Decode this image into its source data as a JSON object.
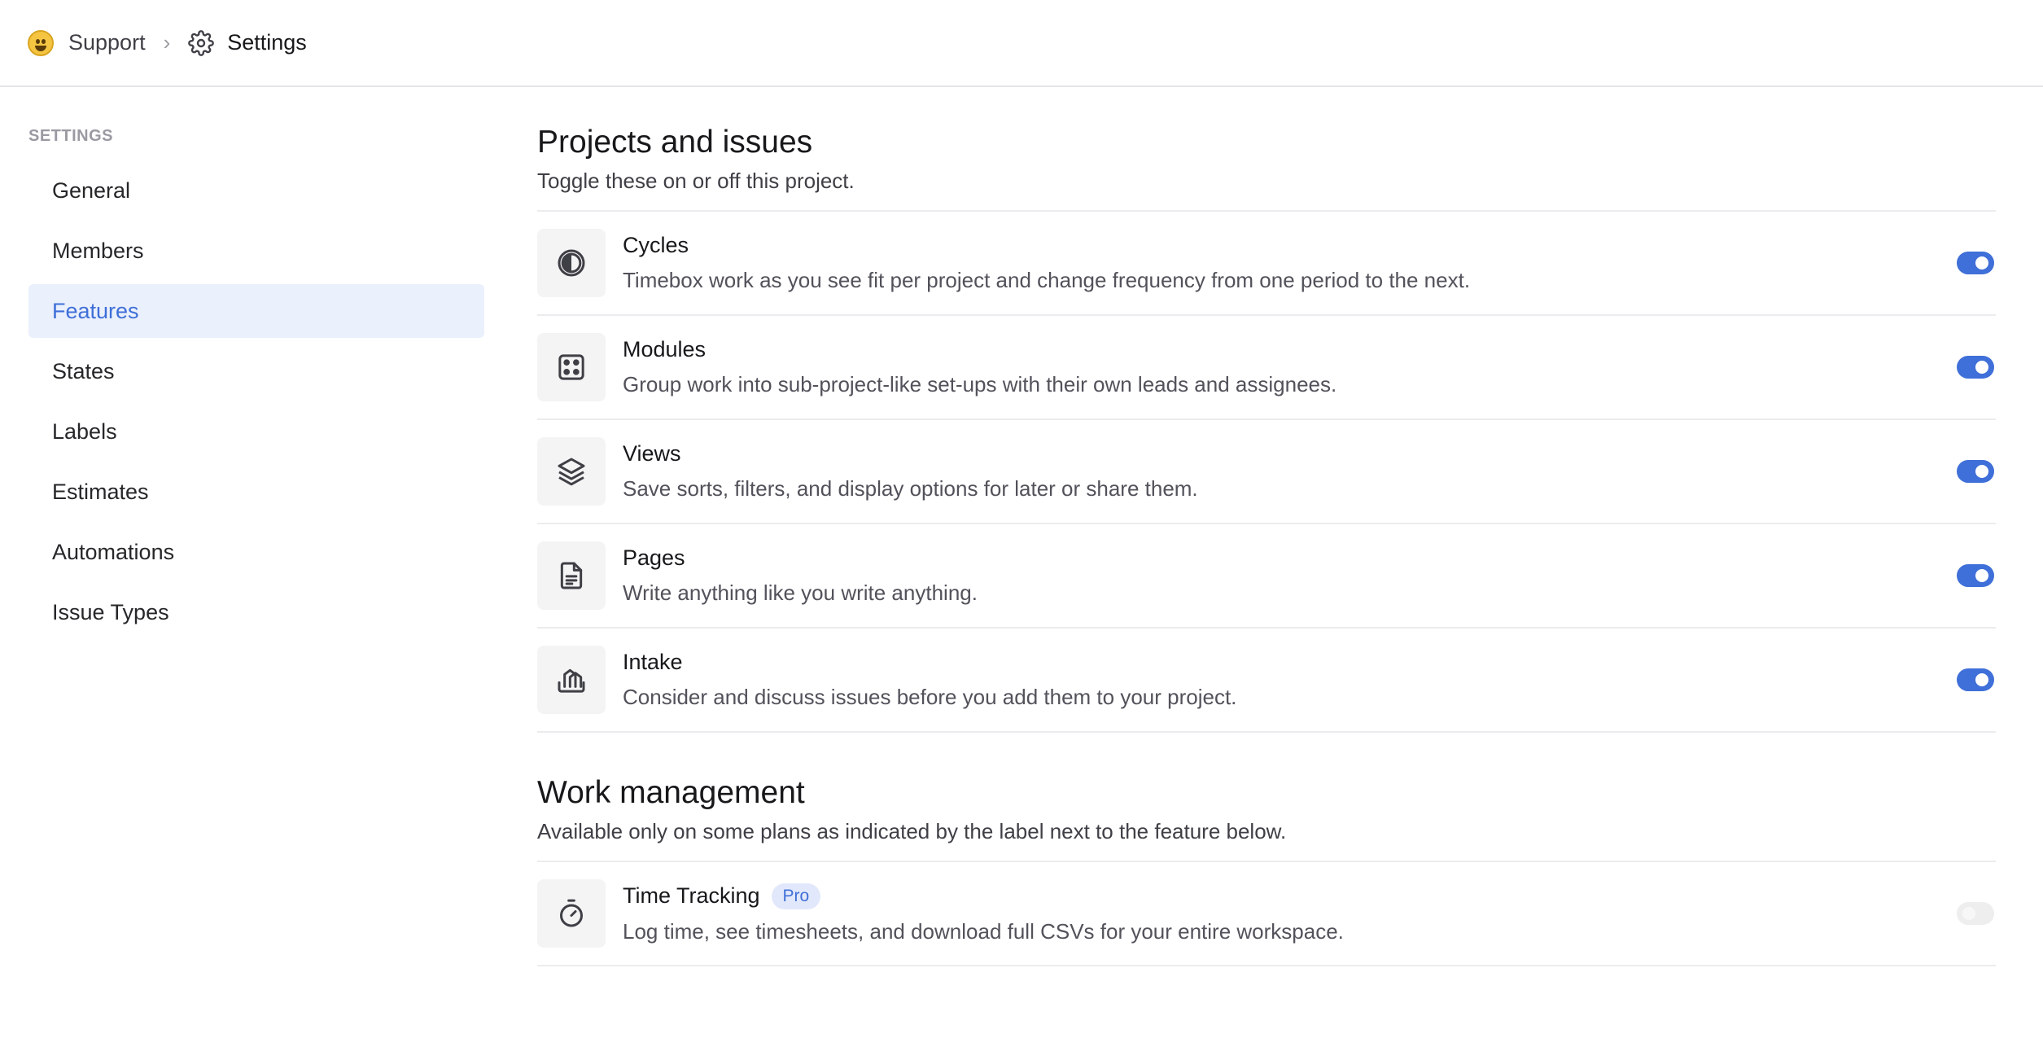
{
  "breadcrumb": {
    "project": "Support",
    "separator": "›",
    "page": "Settings"
  },
  "sidebar": {
    "heading": "SETTINGS",
    "items": [
      {
        "label": "General",
        "active": false
      },
      {
        "label": "Members",
        "active": false
      },
      {
        "label": "Features",
        "active": true
      },
      {
        "label": "States",
        "active": false
      },
      {
        "label": "Labels",
        "active": false
      },
      {
        "label": "Estimates",
        "active": false
      },
      {
        "label": "Automations",
        "active": false
      },
      {
        "label": "Issue Types",
        "active": false
      }
    ]
  },
  "projects_section": {
    "title": "Projects and issues",
    "subtitle": "Toggle these on or off this project.",
    "features": [
      {
        "icon": "contrast-circle-icon",
        "title": "Cycles",
        "description": "Timebox work as you see fit per project and change frequency from one period to the next.",
        "enabled": true
      },
      {
        "icon": "dice-icon",
        "title": "Modules",
        "description": "Group work into sub-project-like set-ups with their own leads and assignees.",
        "enabled": true
      },
      {
        "icon": "layers-icon",
        "title": "Views",
        "description": "Save sorts, filters, and display options for later or share them.",
        "enabled": true
      },
      {
        "icon": "document-icon",
        "title": "Pages",
        "description": "Write anything like you write anything.",
        "enabled": true
      },
      {
        "icon": "intake-icon",
        "title": "Intake",
        "description": "Consider and discuss issues before you add them to your project.",
        "enabled": true
      }
    ]
  },
  "work_section": {
    "title": "Work management",
    "subtitle": "Available only on some plans as indicated by the label next to the feature below.",
    "features": [
      {
        "icon": "timer-icon",
        "title": "Time Tracking",
        "badge": "Pro",
        "description": "Log time, see timesheets, and download full CSVs for your entire workspace.",
        "enabled": false
      }
    ]
  },
  "colors": {
    "accent": "#3f6fd8",
    "active_bg": "#eaf0fc",
    "toggle_off": "#eeeeef"
  }
}
